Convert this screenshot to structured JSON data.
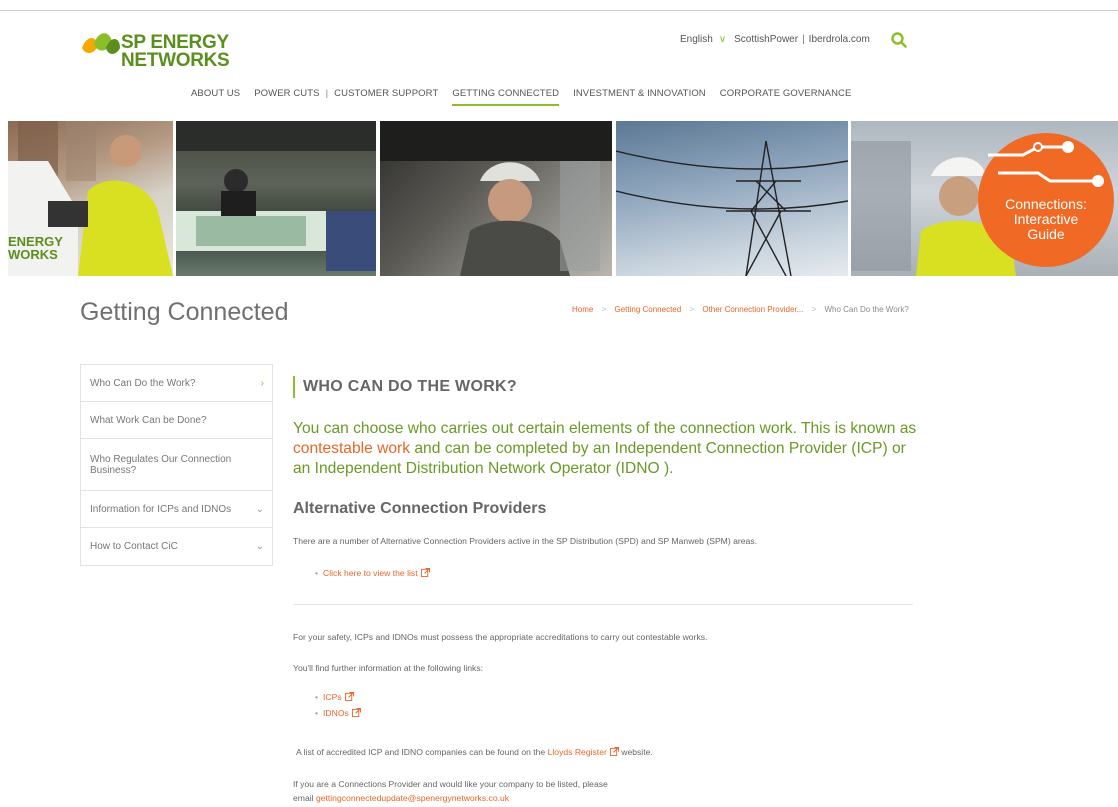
{
  "header": {
    "logo_line1": "SP ENERGY",
    "logo_line2": "NETWORKS",
    "language": "English",
    "links": [
      "ScottishPower",
      "Iberdrola.com"
    ]
  },
  "nav": {
    "items": [
      "ABOUT US",
      "POWER CUTS",
      "CUSTOMER SUPPORT",
      "GETTING CONNECTED",
      "INVESTMENT & INNOVATION",
      "CORPORATE GOVERNANCE"
    ],
    "active": "GETTING CONNECTED"
  },
  "banner": {
    "cta_line1": "Connections:",
    "cta_line2": "Interactive",
    "cta_line3": "Guide",
    "van_text1": "ENERGY",
    "van_text2": "WORKS"
  },
  "page": {
    "title": "Getting Connected",
    "breadcrumb": [
      "Home",
      "Getting Connected",
      "Other Connection Provider...",
      "Who Can Do the Work?"
    ]
  },
  "sidebar": {
    "items": [
      {
        "label": "Who Can Do the Work?"
      },
      {
        "label": "What Work Can be Done?"
      },
      {
        "label": "Who Regulates Our Connection Business?"
      },
      {
        "label": "Information for ICPs and IDNOs"
      },
      {
        "label": "How to Contact CiC"
      }
    ]
  },
  "content": {
    "section_title": "WHO CAN DO THE WORK?",
    "intro_part1": "You can choose who carries out certain elements of the connection work. This is known as",
    "intro_link": "contestable work",
    "intro_part2": " and can be completed by an Independent Connection Provider (ICP) or an Independent Distribution Network Operator (IDNO ).",
    "subheading": "Alternative Connection Providers",
    "para1": "There are a number of Alternative Connection Providers active in the SP Distribution (SPD) and SP Manweb (SPM) areas.",
    "list_link": "Click here to view the list",
    "para2": "For your safety, ICPs and IDNOs must possess the appropriate accreditations to carry out contestable works.",
    "para3": "You'll find further information at the following links:",
    "link_icps": "ICPs",
    "link_idnos": "IDNOs",
    "para4_pre": "A list of accredited ICP and IDNO companies can be found on the",
    "para4_link": "Lloyds Register",
    "para4_post": " website.",
    "para5": "If you are a Connections Provider and would like your company to be listed, please",
    "para6_pre": "email",
    "email": "gettingconnectedupdate@spenergynetworks.co.uk"
  },
  "colors": {
    "brand_green": "#8bbf2a",
    "text_green": "#6a9a26",
    "link_orange": "#e8662a",
    "cta_orange": "#f06a25"
  }
}
